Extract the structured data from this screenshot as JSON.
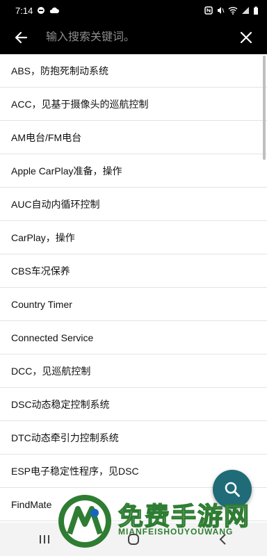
{
  "status": {
    "time": "7:14"
  },
  "header": {
    "search_placeholder": "输入搜索关键词。"
  },
  "list_items": [
    "ABS，防抱死制动系统",
    "ACC，见基于摄像头的巡航控制",
    "AM电台/FM电台",
    "Apple CarPlay准备，操作",
    "AUC自动内循环控制",
    "CarPlay，操作",
    "CBS车况保养",
    "Country Timer",
    "Connected Service",
    "DCC，见巡航控制",
    "DSC动态稳定控制系统",
    "DTC动态牵引力控制系统",
    "ESP电子稳定性程序，见DSC",
    "FindMate"
  ],
  "watermark": {
    "title": "免费手游网",
    "subtitle": "MIANFEISHOUYOUWANG"
  },
  "colors": {
    "fab": "#1f6b78",
    "watermark_green": "#2e7d32"
  }
}
